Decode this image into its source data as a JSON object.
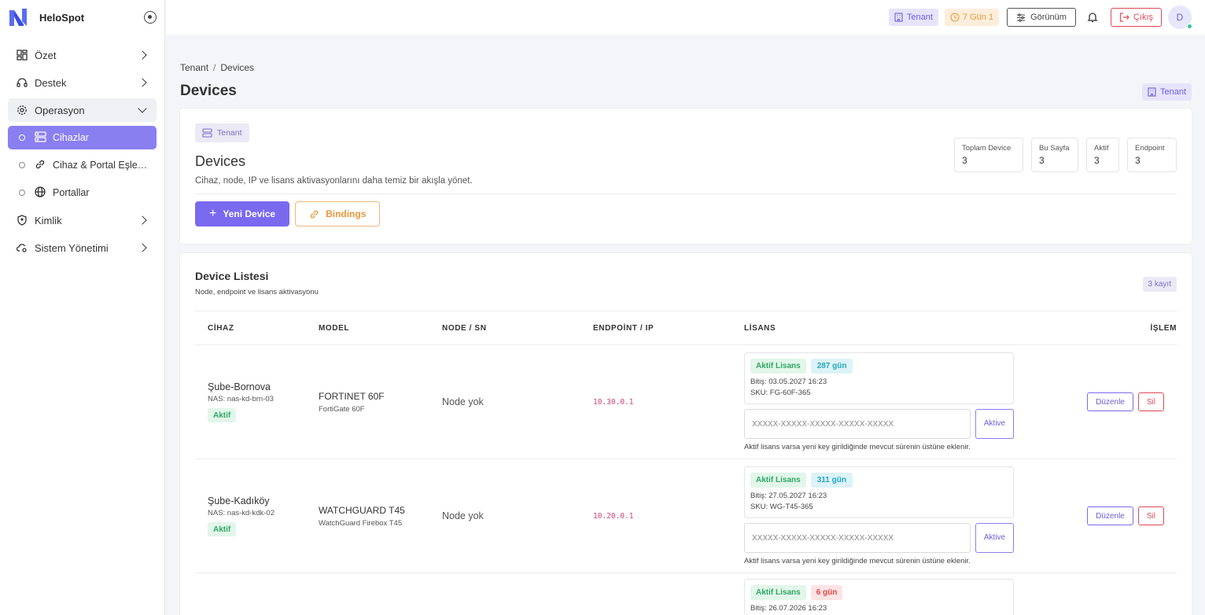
{
  "app": {
    "name": "HeloSpot"
  },
  "sidebar": {
    "items": [
      {
        "label": "Özet"
      },
      {
        "label": "Destek"
      },
      {
        "label": "Operasyon"
      },
      {
        "label": "Kimlik"
      },
      {
        "label": "Sistem Yönetimi"
      }
    ],
    "sub_items": [
      {
        "label": "Cihazlar"
      },
      {
        "label": "Cihaz & Portal Eşleşti..."
      },
      {
        "label": "Portallar"
      }
    ]
  },
  "topbar": {
    "tenant": "Tenant",
    "days": "7 Gün 1",
    "view_label": "Görünüm",
    "exit_label": "Çıkış",
    "avatar_initial": "D"
  },
  "breadcrumb": {
    "root": "Tenant",
    "current": "Devices"
  },
  "page": {
    "title": "Devices",
    "tenant_badge": "Tenant"
  },
  "summary": {
    "tenant_chip": "Tenant",
    "title": "Devices",
    "description": "Cihaz, node, IP ve lisans aktivasyonlarını daha temiz bir akışla yönet.",
    "new_device": "Yeni Device",
    "bindings": "Bindings",
    "stats": [
      {
        "label": "Toplam Device",
        "value": "3"
      },
      {
        "label": "Bu Sayfa",
        "value": "3"
      },
      {
        "label": "Aktif",
        "value": "3"
      },
      {
        "label": "Endpoint",
        "value": "3"
      }
    ]
  },
  "list": {
    "title": "Device Listesi",
    "subtitle": "Node, endpoint ve lisans aktivasyonu",
    "count": "3 kayıt",
    "columns": [
      "CİHAZ",
      "MODEL",
      "NODE / SN",
      "ENDPOİNT / IP",
      "LİSANS",
      "İŞLEM"
    ],
    "rows": [
      {
        "name": "Şube-Bornova",
        "nas": "NAS: nas-kd-brn-03",
        "status": "Aktif",
        "model": "FORTINET 60F",
        "model_sub": "FortiGate 60F",
        "node": "Node yok",
        "endpoint": "10.30.0.1",
        "license_status": "Aktif Lisans",
        "days": "287 gün",
        "end": "Bitiş: 03.05.2027 16:23",
        "sku": "SKU: FG-60F-365",
        "key_placeholder": "XXXXX-XXXXX-XXXXX-XXXXX-XXXXX",
        "activate": "Aktive",
        "hint": "Aktif lisans varsa yeni key girildiğinde mevcut sürenin üstüne eklenir.",
        "edit": "Düzenle",
        "delete": "Sil"
      },
      {
        "name": "Şube-Kadıköy",
        "nas": "NAS: nas-kd-kdk-02",
        "status": "Aktif",
        "model": "WATCHGUARD T45",
        "model_sub": "WatchGuard Firebox T45",
        "node": "Node yok",
        "endpoint": "10.20.0.1",
        "license_status": "Aktif Lisans",
        "days": "311 gün",
        "end": "Bitiş: 27.05.2027 16:23",
        "sku": "SKU: WG-T45-365",
        "key_placeholder": "XXXXX-XXXXX-XXXXX-XXXXX-XXXXX",
        "activate": "Aktive",
        "hint": "Aktif lisans varsa yeni key girildiğinde mevcut sürenin üstüne eklenir.",
        "edit": "Düzenle",
        "delete": "Sil"
      },
      {
        "license_status": "Aktif Lisans",
        "days": "6 gün",
        "end": "Bitiş: 26.07.2026 16:23"
      }
    ]
  }
}
